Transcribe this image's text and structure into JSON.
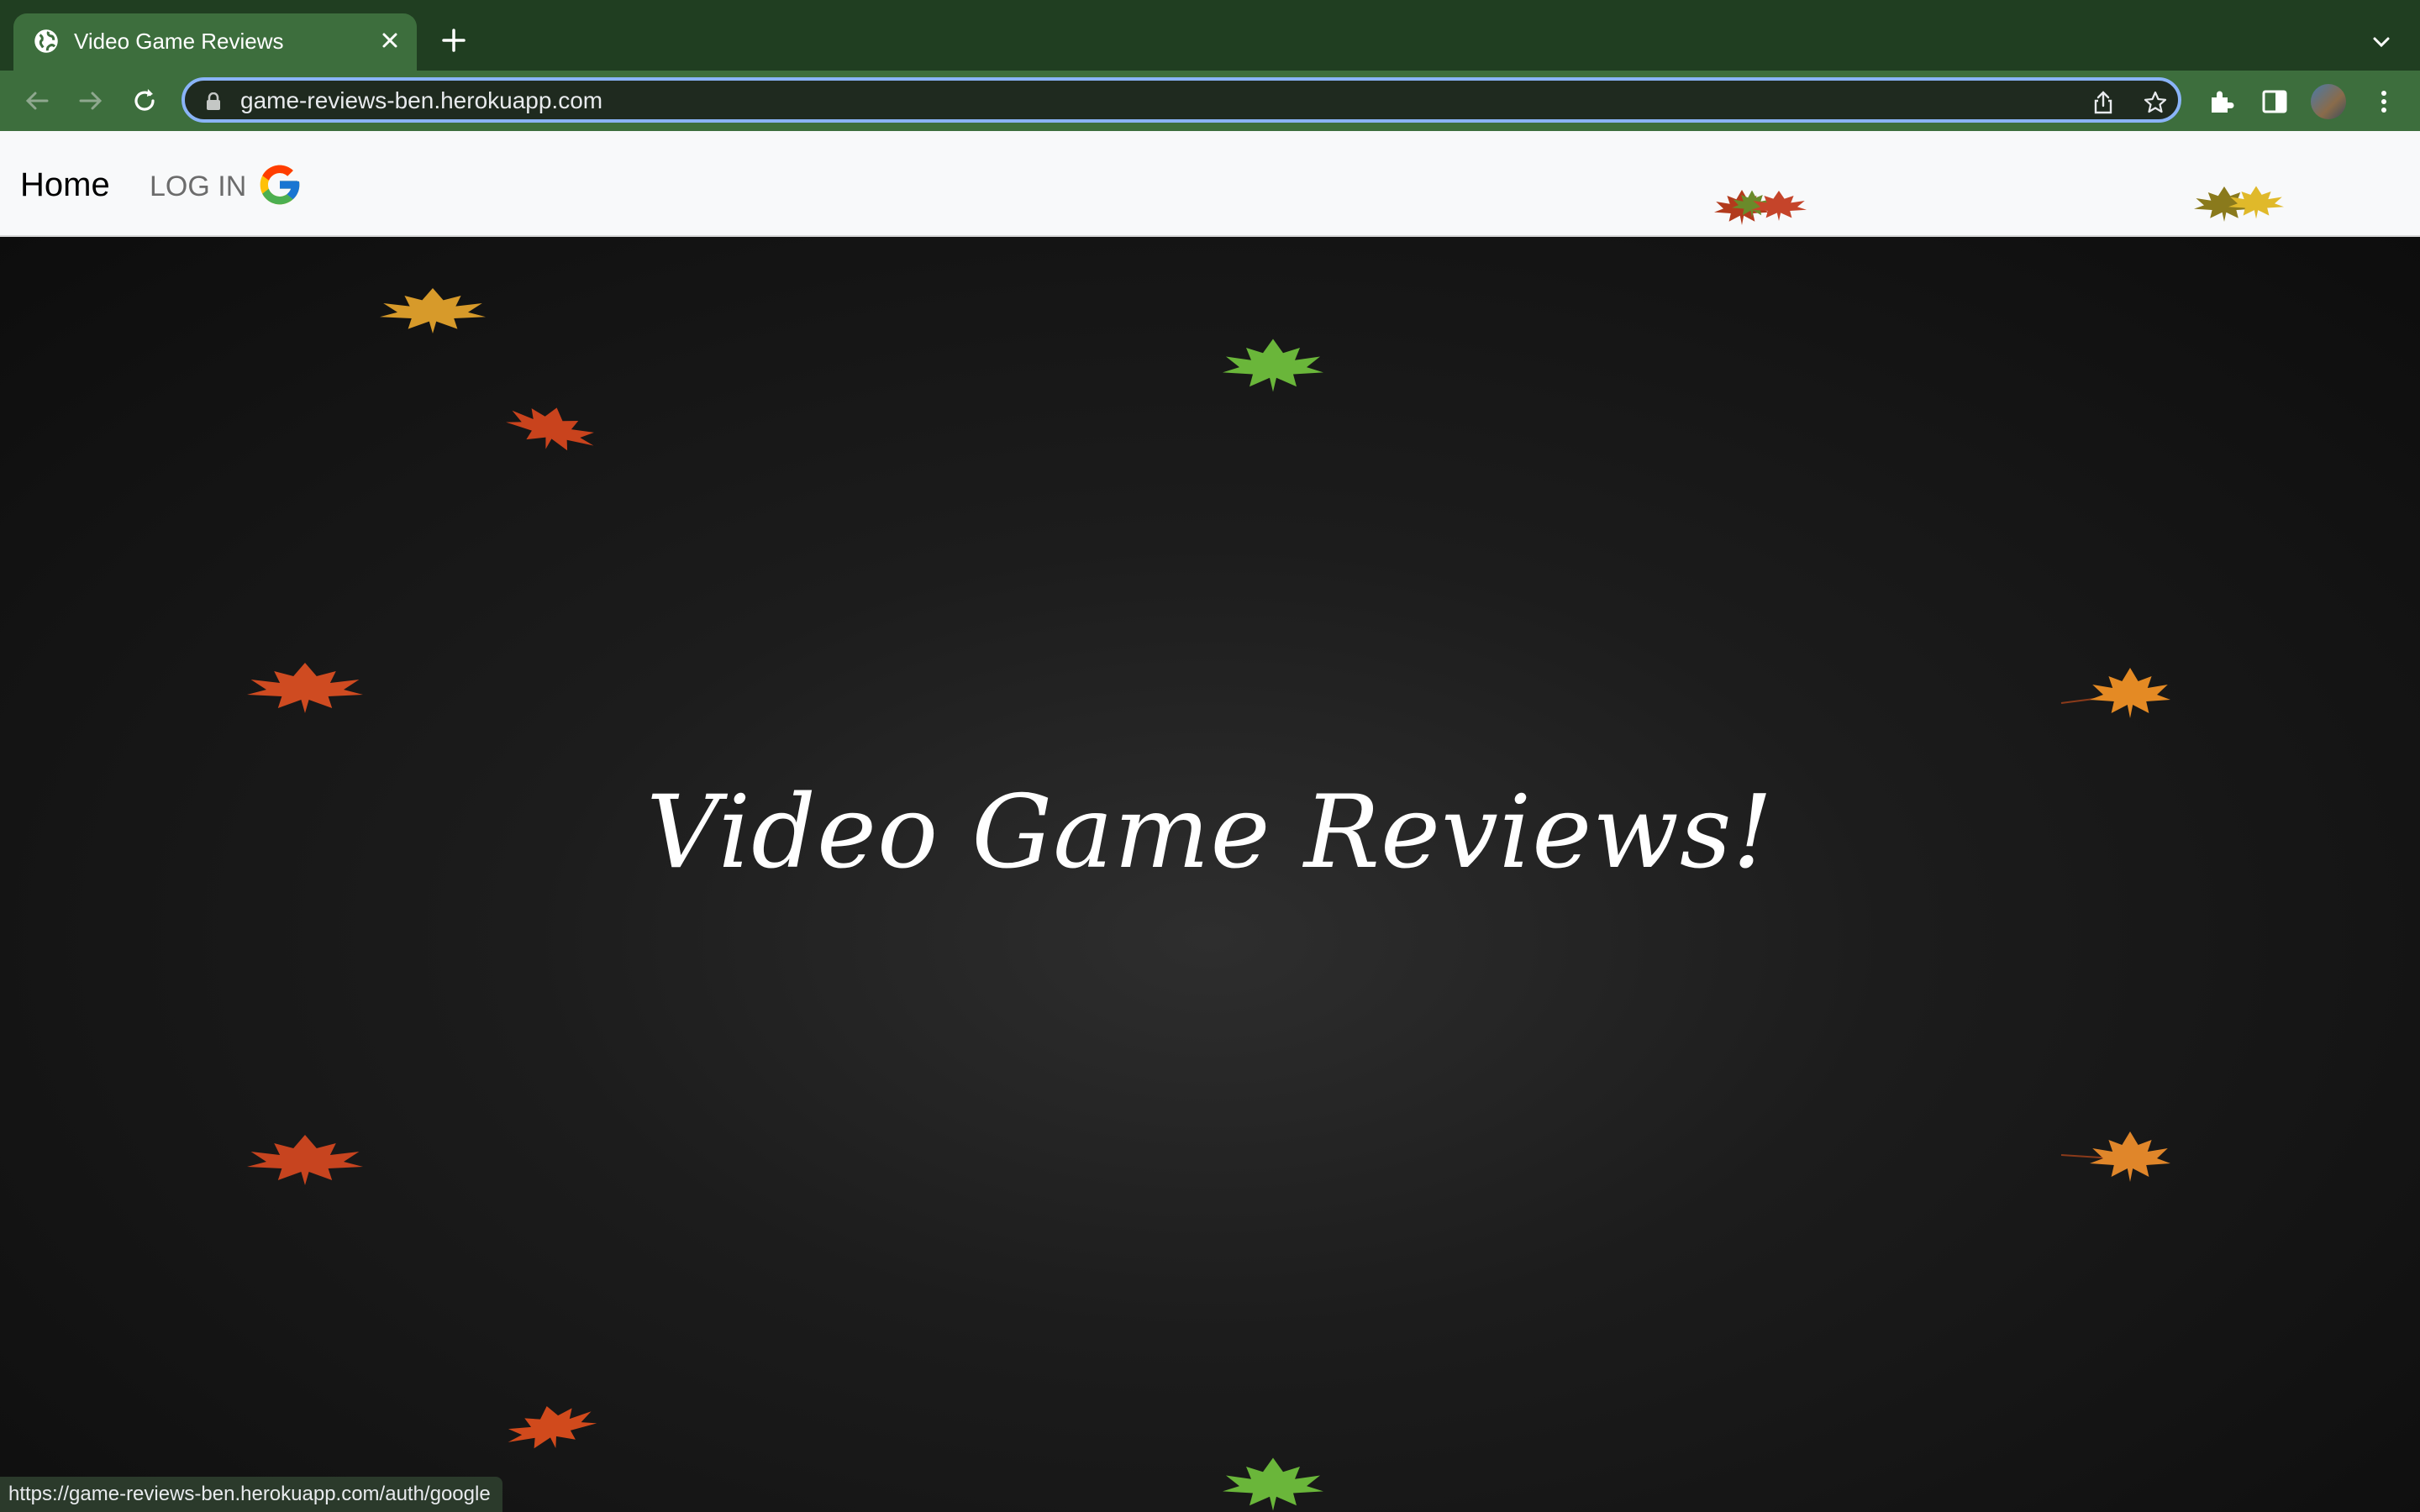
{
  "browser": {
    "tab": {
      "title": "Video Game Reviews",
      "favicon": "globe-icon"
    },
    "address_bar": {
      "url": "game-reviews-ben.herokuapp.com"
    },
    "status_url": "https://game-reviews-ben.herokuapp.com/auth/google"
  },
  "page": {
    "nav": {
      "home_label": "Home",
      "login_label": "LOG IN",
      "login_icon": "google-logo-icon"
    },
    "hero": {
      "title": "Video Game Reviews!"
    }
  },
  "colors": {
    "tab_strip": "#203e21",
    "toolbar": "#3d6e3d",
    "hero_background": "#1c1c1c"
  }
}
